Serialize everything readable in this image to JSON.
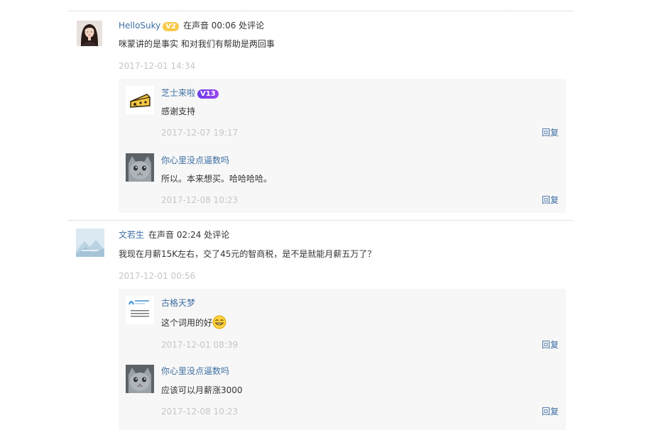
{
  "comments": [
    {
      "user": "HelloSuky",
      "badge": "V2",
      "position_text": "在声音 00:06 处评论",
      "text": "咪蒙讲的是事实 和对我们有帮助是两回事",
      "time": "2017-12-01 14:34",
      "avatar_icon": "woman-portrait-avatar",
      "replies": [
        {
          "user": "芝士来啦",
          "badge": "V13",
          "text": "感谢支持",
          "time": "2017-12-07 19:17",
          "reply_label": "回复",
          "avatar_icon": "cheese-avatar"
        },
        {
          "user": "你心里没点逼数吗",
          "text": "所以。本来想买。哈哈哈哈。",
          "time": "2017-12-08 10:23",
          "reply_label": "回复",
          "avatar_icon": "grey-cat-avatar"
        }
      ]
    },
    {
      "user": "文若生",
      "position_text": "在声音 02:24 处评论",
      "text": "我现在月薪15K左右，交了45元的智商税，是不是就能月薪五万了？",
      "time": "2017-12-01 00:56",
      "avatar_icon": "default-landscape-avatar",
      "replies": [
        {
          "user": "古格天梦",
          "text": "这个词用的好",
          "emoji": "grin-emoji",
          "time": "2017-12-01 08:39",
          "reply_label": "回复",
          "avatar_icon": "qq-browser-avatar"
        },
        {
          "user": "你心里没点逼数吗",
          "text": "应该可以月薪涨3000",
          "time": "2017-12-08 10:23",
          "reply_label": "回复",
          "avatar_icon": "grey-cat-avatar"
        }
      ]
    }
  ],
  "colors": {
    "username": "#3e6fa3",
    "timestamp": "#c6c6c6",
    "reply_bg": "#f7f7f7",
    "badge_v2": "#f7c948",
    "badge_v13": "#7b3fe8"
  }
}
